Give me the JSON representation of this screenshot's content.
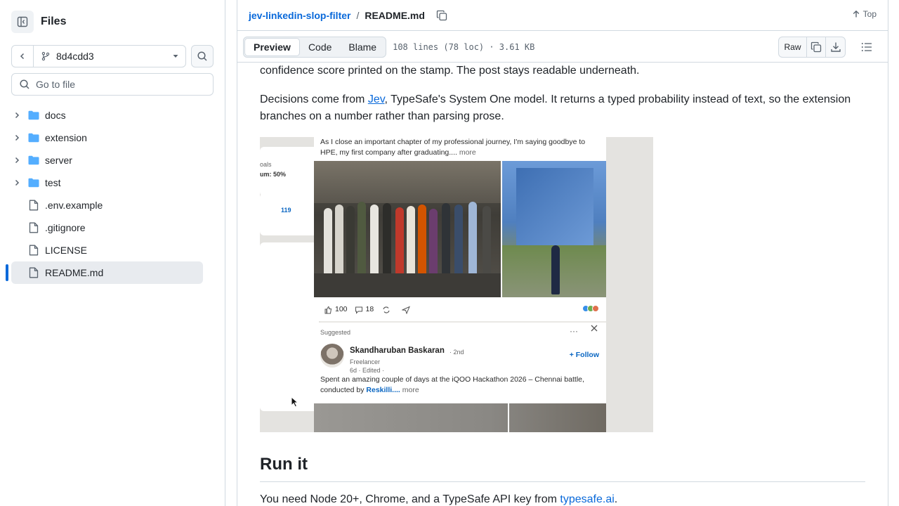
{
  "sidebar": {
    "title": "Files",
    "branch": "8d4cdd3",
    "goto_placeholder": "Go to file",
    "items": [
      {
        "label": "docs",
        "type": "folder"
      },
      {
        "label": "extension",
        "type": "folder"
      },
      {
        "label": "server",
        "type": "folder"
      },
      {
        "label": "test",
        "type": "folder"
      },
      {
        "label": ".env.example",
        "type": "file"
      },
      {
        "label": ".gitignore",
        "type": "file"
      },
      {
        "label": "LICENSE",
        "type": "file"
      },
      {
        "label": "README.md",
        "type": "file",
        "active": true
      }
    ]
  },
  "header": {
    "repo": "jev-linkedin-slop-filter",
    "separator": "/",
    "file": "README.md",
    "top_label": "Top"
  },
  "filebar": {
    "tabs": [
      "Preview",
      "Code",
      "Blame"
    ],
    "active_tab": "Preview",
    "meta": "108 lines (78 loc) · 3.61 KB",
    "raw_label": "Raw"
  },
  "readme": {
    "cut_para": "confidence score printed on the stamp. The post stays readable underneath.",
    "p1_before": "Decisions come from ",
    "p1_link": "Jev",
    "p1_after": ", TypeSafe's System One model. It returns a typed probability instead of text, so the extension branches on a number rather than parsing prose.",
    "heading": "Run it",
    "p2_before": "You need Node 20+, Chrome, and a TypeSafe API key from ",
    "p2_link": "typesafe.ai",
    "p2_after": "."
  },
  "screenshot": {
    "post_text": "As I close an important chapter of my professional journey, I'm saying goodbye to HPE, my first company after graduating....",
    "post_more": "more",
    "side_goals": "oals",
    "side_progress": "um: 50%",
    "side_count": "119",
    "reactions": "100",
    "comments": "18",
    "suggested_label": "Suggested",
    "author_name": "Skandharuban Baskaran",
    "author_degree": "· 2nd",
    "author_role": "Freelancer",
    "author_time": "6d · Edited ·",
    "follow_label": "+ Follow",
    "post2_text": "Spent an amazing couple of days at the iQOO Hackathon 2026 – Chennai battle, conducted by",
    "post2_link": "Reskilli....",
    "post2_more": "more"
  },
  "colors": {
    "accent": "#0969da",
    "border": "#d1d9e0",
    "folder": "#54aeff",
    "text": "#1f2328",
    "muted": "#59636e"
  }
}
